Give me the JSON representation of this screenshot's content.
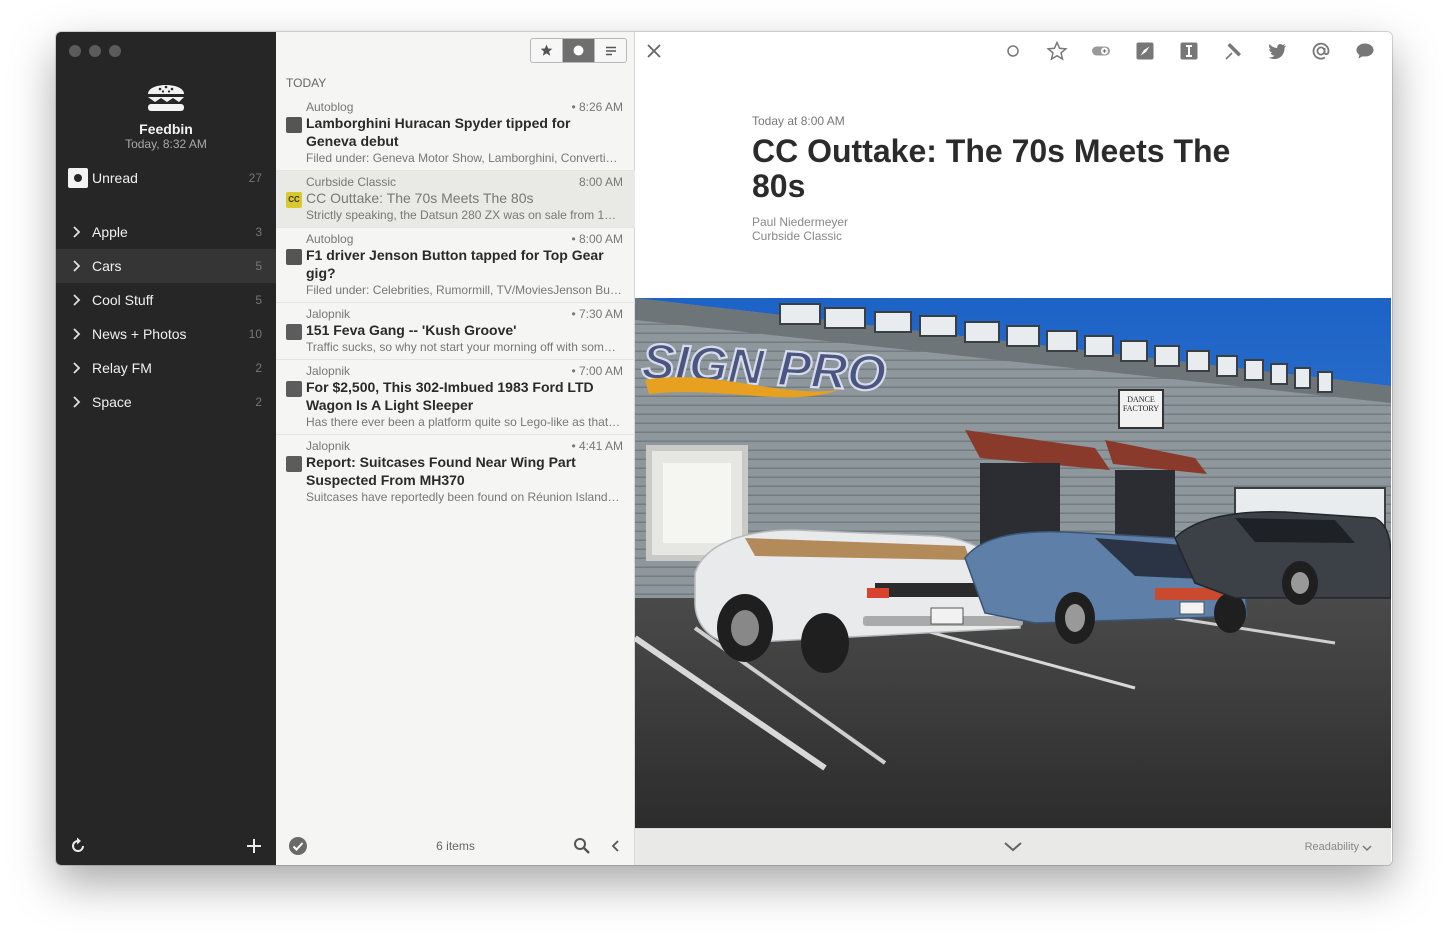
{
  "sidebar": {
    "app_name": "Feedbin",
    "last_refresh": "Today, 8:32 AM",
    "unread": {
      "label": "Unread",
      "count": "27"
    },
    "categories": [
      {
        "label": "Apple",
        "count": "3"
      },
      {
        "label": "Cars",
        "count": "5"
      },
      {
        "label": "Cool Stuff",
        "count": "5"
      },
      {
        "label": "News + Photos",
        "count": "10"
      },
      {
        "label": "Relay FM",
        "count": "2"
      },
      {
        "label": "Space",
        "count": "2"
      }
    ]
  },
  "list": {
    "section": "TODAY",
    "items_count": "6 items",
    "entries": [
      {
        "source": "Autoblog",
        "time": "• 8:26 AM",
        "title": "Lamborghini Huracan Spyder tipped for Geneva debut",
        "summary": "Filed under: Geneva Motor Show, Lamborghini, Converti…"
      },
      {
        "source": "Curbside Classic",
        "time": "8:00 AM",
        "title": "CC Outtake: The 70s Meets The 80s",
        "summary": "Strictly speaking, the Datsun 280 ZX was on sale from 1…",
        "favicon_text": "CC"
      },
      {
        "source": "Autoblog",
        "time": "• 8:00 AM",
        "title": "F1 driver Jenson Button tapped for Top Gear gig?",
        "summary": "Filed under: Celebrities, Rumormill, TV/MoviesJenson Bu…"
      },
      {
        "source": "Jalopnik",
        "time": "• 7:30 AM",
        "title": "151 Feva Gang -- 'Kush Groove'",
        "summary": "Traffic sucks, so why not start your morning off with som…"
      },
      {
        "source": "Jalopnik",
        "time": "• 7:00 AM",
        "title": "For $2,500, This 302-Imbued 1983 Ford LTD Wagon Is A Light Sleeper",
        "summary": "Has there ever been a platform quite so Lego-like as that…"
      },
      {
        "source": "Jalopnik",
        "time": "• 4:41 AM",
        "title": "Report: Suitcases Found Near Wing Part Suspected From MH370",
        "summary": "Suitcases have reportedly been found on Réunion Island…"
      }
    ]
  },
  "article": {
    "published": "Today at 8:00 AM",
    "title": "CC Outtake: The 70s Meets The 80s",
    "author": "Paul Niedermeyer",
    "feed": "Curbside Classic",
    "photo_signs": {
      "sign_pro": "SIGN PRO",
      "dance_factory": "DANCE FACTORY"
    },
    "readability_label": "Readability"
  },
  "colors": {
    "sidebar_bg": "#262626",
    "list_bg": "#f5f5f3",
    "accent": "#6f6f6f"
  }
}
